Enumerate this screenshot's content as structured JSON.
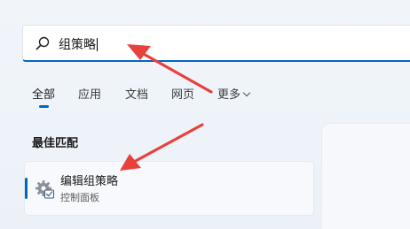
{
  "search": {
    "query": "组策略"
  },
  "tabs": [
    {
      "label": "全部"
    },
    {
      "label": "应用"
    },
    {
      "label": "文档"
    },
    {
      "label": "网页"
    },
    {
      "label": "更多"
    }
  ],
  "best_match": {
    "section_title": "最佳匹配",
    "title": "编辑组策略",
    "subtitle": "控制面板",
    "icon": "gear-icon"
  },
  "colors": {
    "accent": "#0067c0",
    "annotation_arrow": "#e8413c"
  }
}
